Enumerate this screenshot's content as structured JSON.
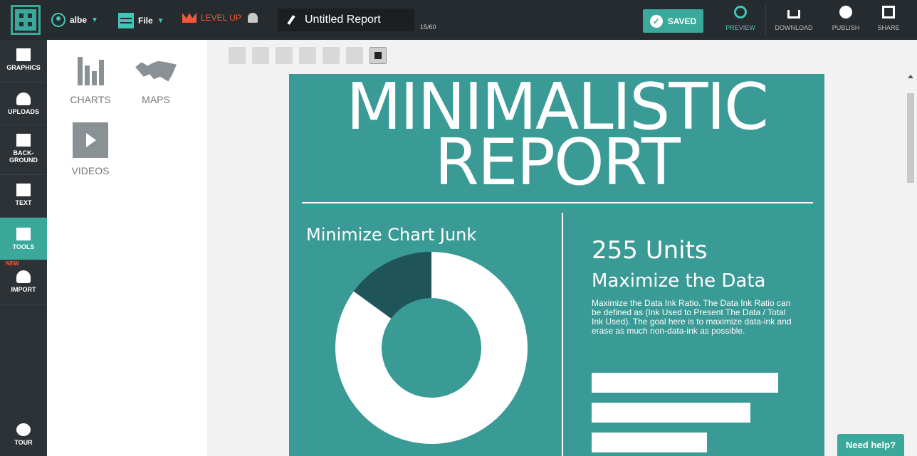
{
  "colors": {
    "accent": "#3aa89a",
    "canvas": "#3a9a95",
    "topbar": "#262b2f",
    "sidebar": "#2d3236",
    "levelup": "#f05a3a",
    "donut_dark": "#1f5559"
  },
  "topbar": {
    "user": "albe",
    "file": "File",
    "levelup": "LEVEL UP",
    "title": "Untitled Report",
    "count": "15/60",
    "saved": "SAVED",
    "actions": [
      {
        "label": "PREVIEW",
        "icon": "eye-icon"
      },
      {
        "label": "DOWNLOAD",
        "icon": "download-icon"
      },
      {
        "label": "PUBLISH",
        "icon": "globe-icon"
      },
      {
        "label": "SHARE",
        "icon": "share-icon"
      }
    ]
  },
  "sidebar": {
    "items": [
      {
        "label": "GRAPHICS",
        "icon": "image-icon"
      },
      {
        "label": "UPLOADS",
        "icon": "upload-cloud-icon"
      },
      {
        "label": "BACK-",
        "label2": "GROUND",
        "icon": "background-icon"
      },
      {
        "label": "TEXT",
        "icon": "text-icon"
      },
      {
        "label": "TOOLS",
        "icon": "tools-icon",
        "active": true
      },
      {
        "label": "IMPORT",
        "icon": "import-cloud-icon",
        "tag": "NEW"
      }
    ],
    "tour": "TOUR"
  },
  "panel": {
    "items": [
      {
        "label": "CHARTS",
        "icon": "bar-chart-icon"
      },
      {
        "label": "MAPS",
        "icon": "world-map-icon"
      },
      {
        "label": "VIDEOS",
        "icon": "play-icon"
      }
    ]
  },
  "canvas": {
    "title_line1": "MINIMALISTIC",
    "title_line2": "REPORT",
    "left_heading": "Minimize Chart Junk",
    "right_big": "255 Units",
    "right_heading": "Maximize the Data",
    "body": "Maximize the Data Ink Ratio. The Data Ink Ratio can be defined as (Ink Used to Present The Data / Total Ink Used). The goal here is to maximize data-ink and erase as much non-data-ink as possible."
  },
  "chart_data": [
    {
      "type": "pie",
      "categories": [
        "",
        ""
      ],
      "values": [
        15,
        85
      ]
    },
    {
      "type": "bar",
      "categories": [
        "",
        "",
        ""
      ],
      "values": [
        100,
        85,
        62
      ]
    }
  ],
  "help": "Need help?"
}
